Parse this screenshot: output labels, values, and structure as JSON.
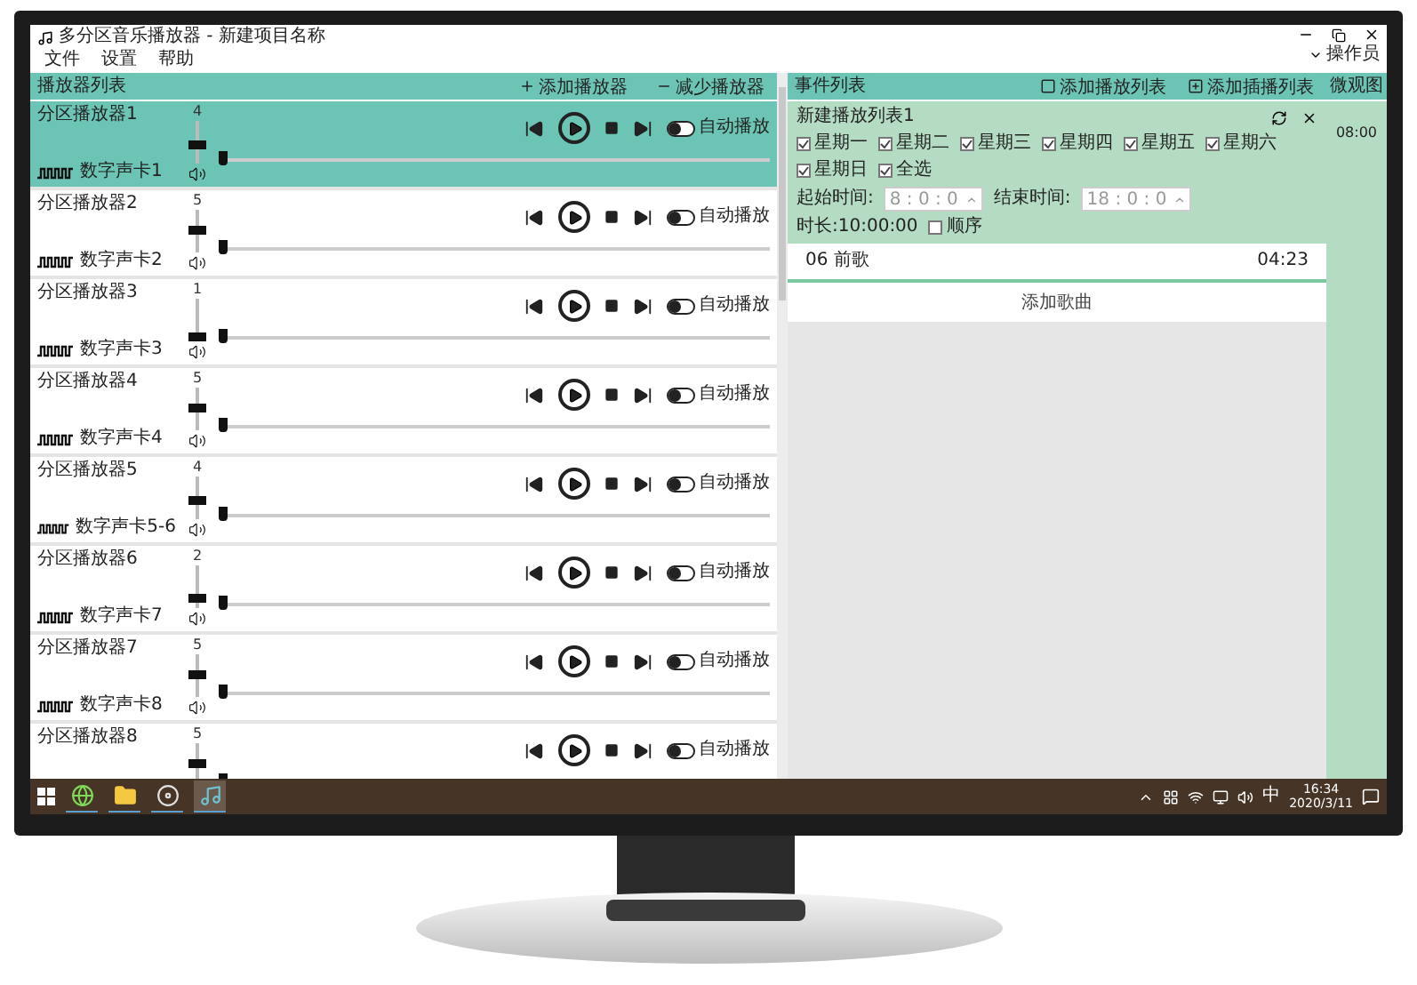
{
  "window": {
    "title": "多分区音乐播放器 - 新建项目名称",
    "menu": [
      "文件",
      "设置",
      "帮助"
    ],
    "user": "操作员"
  },
  "player_panel": {
    "title": "播放器列表",
    "actions": [
      {
        "kind": "add",
        "label": "添加播放器"
      },
      {
        "kind": "remove",
        "label": "减少播放器"
      }
    ]
  },
  "players": [
    {
      "name": "分区播放器1",
      "volume": {
        "reading": "4",
        "level": 0.4
      },
      "progress": {
        "level": 0
      },
      "card": "数字声卡1",
      "auto_play": false,
      "auto_play_label": "自动播放",
      "selected": true
    },
    {
      "name": "分区播放器2",
      "volume": {
        "reading": "5",
        "level": 0.5
      },
      "progress": {
        "level": 0
      },
      "card": "数字声卡2",
      "auto_play": false,
      "auto_play_label": "自动播放",
      "selected": false
    },
    {
      "name": "分区播放器3",
      "volume": {
        "reading": "1",
        "level": 0.1
      },
      "progress": {
        "level": 0
      },
      "card": "数字声卡3",
      "auto_play": false,
      "auto_play_label": "自动播放",
      "selected": false
    },
    {
      "name": "分区播放器4",
      "volume": {
        "reading": "5",
        "level": 0.5
      },
      "progress": {
        "level": 0
      },
      "card": "数字声卡4",
      "auto_play": false,
      "auto_play_label": "自动播放",
      "selected": false
    },
    {
      "name": "分区播放器5",
      "volume": {
        "reading": "4",
        "level": 0.4
      },
      "progress": {
        "level": 0
      },
      "card": "数字声卡5-6",
      "auto_play": false,
      "auto_play_label": "自动播放",
      "selected": false
    },
    {
      "name": "分区播放器6",
      "volume": {
        "reading": "2",
        "level": 0.2
      },
      "progress": {
        "level": 0
      },
      "card": "数字声卡7",
      "auto_play": false,
      "auto_play_label": "自动播放",
      "selected": false
    },
    {
      "name": "分区播放器7",
      "volume": {
        "reading": "5",
        "level": 0.5
      },
      "progress": {
        "level": 0
      },
      "card": "数字声卡8",
      "auto_play": false,
      "auto_play_label": "自动播放",
      "selected": false
    },
    {
      "name": "分区播放器8",
      "volume": {
        "reading": "5",
        "level": 0.5
      },
      "progress": {
        "level": 0
      },
      "auto_play": false,
      "auto_play_label": "自动播放",
      "selected": false
    }
  ],
  "event_panel": {
    "title": "事件列表",
    "actions": [
      {
        "kind": "playlist",
        "label": "添加播放列表"
      },
      {
        "kind": "insert",
        "label": "添加插播列表"
      }
    ],
    "playlists": [
      {
        "title": "新建播放列表1",
        "days": [
          {
            "label": "星期一",
            "checked": true
          },
          {
            "label": "星期二",
            "checked": true
          },
          {
            "label": "星期三",
            "checked": true
          },
          {
            "label": "星期四",
            "checked": true
          },
          {
            "label": "星期五",
            "checked": true
          },
          {
            "label": "星期六",
            "checked": true
          },
          {
            "label": "星期日",
            "checked": true
          }
        ],
        "select_all": {
          "label": "全选",
          "checked": true
        },
        "start_label": "起始时间:",
        "start": "8 : 0 : 0",
        "end_label": "结束时间:",
        "end": "18 : 0 : 0",
        "duration": "时长:10:00:00",
        "ordered": {
          "label": "顺序",
          "checked": false
        },
        "songs": [
          {
            "title": "06 前歌",
            "length": "04:23"
          }
        ],
        "add_song": "添加歌曲"
      }
    ]
  },
  "timeline": {
    "title": "微观图",
    "entries": [
      "08:00"
    ]
  },
  "taskbar": {
    "apps": [
      {
        "kind": "browser",
        "selected": false
      },
      {
        "kind": "folder",
        "selected": false
      },
      {
        "kind": "disc",
        "selected": false
      },
      {
        "kind": "music",
        "selected": true
      }
    ],
    "input_method": "中",
    "time": "16:34",
    "date": "2020/3/11"
  }
}
